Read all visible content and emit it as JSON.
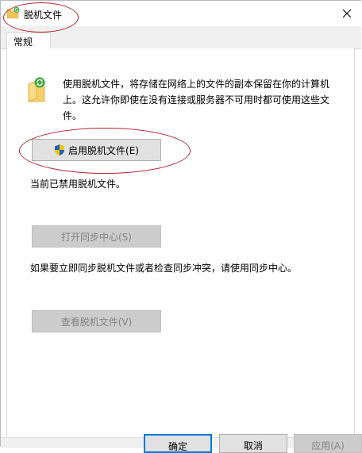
{
  "window": {
    "title": "脱机文件",
    "icons": {
      "title_icon": "offline-files-folder-icon",
      "close": "close-icon"
    }
  },
  "tabs": [
    {
      "label": "常规",
      "selected": true
    }
  ],
  "general": {
    "description": "使用脱机文件，将存储在网络上的文件的副本保留在你的计算机上。这允许你即使在没有连接或服务器不可用时都可使用这些文件。",
    "enable_button": "启用脱机文件(E)",
    "status": "当前已禁用脱机文件。",
    "sync_center_button": "打开同步中心(S)",
    "sync_hint": "如果要立即同步脱机文件或者检查同步冲突，请使用同步中心。",
    "view_files_button": "查看脱机文件(V)"
  },
  "footer": {
    "ok": "确定",
    "cancel": "取消",
    "apply": "应用(A)"
  },
  "colors": {
    "annotation": "#b0202a",
    "focus_blue": "#0078d7",
    "button_bg": "#e1e1e1",
    "disabled_text": "#838383"
  }
}
